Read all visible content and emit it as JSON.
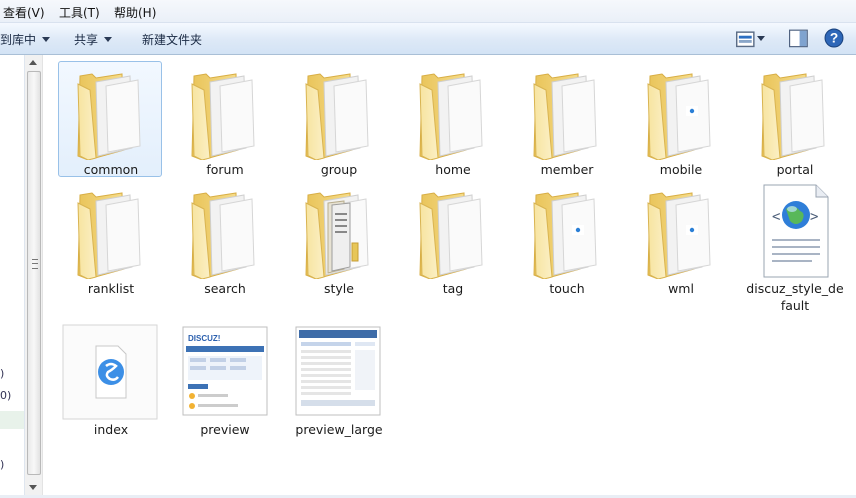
{
  "menubar": {
    "view": "查看(V)",
    "tools": "工具(T)",
    "help": "帮助(H)"
  },
  "toolbar": {
    "library": "到库中",
    "share": "共享",
    "new_folder": "新建文件夹"
  },
  "left_pane": {
    "fragments": [
      ")",
      "0)",
      "",
      ")"
    ]
  },
  "items": [
    {
      "name": "common",
      "icon": "folder-icon",
      "selected": true
    },
    {
      "name": "forum",
      "icon": "folder-icon"
    },
    {
      "name": "group",
      "icon": "folder-icon"
    },
    {
      "name": "home",
      "icon": "folder-icon"
    },
    {
      "name": "member",
      "icon": "folder-icon"
    },
    {
      "name": "mobile",
      "icon": "folder-with-file-icon"
    },
    {
      "name": "portal",
      "icon": "folder-icon"
    },
    {
      "name": "ranklist",
      "icon": "folder-icon"
    },
    {
      "name": "search",
      "icon": "folder-icon"
    },
    {
      "name": "style",
      "icon": "folder-with-documents-icon"
    },
    {
      "name": "tag",
      "icon": "folder-icon"
    },
    {
      "name": "touch",
      "icon": "folder-with-file-icon"
    },
    {
      "name": "wml",
      "icon": "folder-with-file-icon"
    },
    {
      "name": "discuz_style_default",
      "icon": "xml-globe-document-icon"
    },
    {
      "name": "index",
      "icon": "browser-file-icon"
    },
    {
      "name": "preview",
      "icon": "image-thumbnail-icon"
    },
    {
      "name": "preview_large",
      "icon": "image-thumbnail-icon"
    }
  ]
}
